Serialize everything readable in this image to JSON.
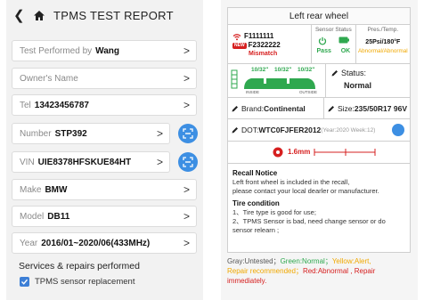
{
  "left": {
    "header": {
      "back_icon": "back-chevron",
      "home_icon": "home-icon",
      "title": "TPMS TEST REPORT"
    },
    "fields": [
      {
        "label": "Test Performed by",
        "value": "Wang"
      },
      {
        "label": "Owner's Name",
        "value": ""
      },
      {
        "label": "Tel",
        "value": "13423456787"
      },
      {
        "label": "Number",
        "value": "STP392"
      },
      {
        "label": "VIN",
        "value": "UIE8378HFSKUE84HT"
      },
      {
        "label": "Make",
        "value": "BMW"
      },
      {
        "label": "Model",
        "value": "DB11"
      },
      {
        "label": "Year",
        "value": "2016/01~2020/06(433MHz)"
      }
    ],
    "services_title": "Services & repairs performed",
    "service_item": "TPMS sensor replacement"
  },
  "right": {
    "title": "Left rear wheel",
    "sensor": {
      "id1": "F1111111",
      "badge": "NEW",
      "id2": "F2322222",
      "mismatch": "Mismatch",
      "status_header": "Sensor Status",
      "pass": "Pass",
      "ok": "OK",
      "pres_header": "Pres./Temp.",
      "pres_value": "25Psi/180°F",
      "pres_status": "Abnormal/Abnormal"
    },
    "tread": {
      "v1": "10/32\"",
      "v2": "10/32\"",
      "v3": "10/32\"",
      "inside": "INSIDE",
      "outside": "OUTSIDE"
    },
    "status_label": "Status:",
    "status_value": "Normal",
    "brand_label": "Brand:",
    "brand_value": "Continental",
    "size_label": "Size:",
    "size_value": "235/50R17 96V",
    "dot_label": "DOT:",
    "dot_value": "WTC0FJFER2012",
    "dot_note": "(Year:2020 Week:12)",
    "measure": "1.6mm",
    "recall": {
      "title": "Recall Notice",
      "line1": "Left front wheel is included in the recall,",
      "line2": "please contact your local dearler or manufacturer.",
      "tire_title": "Tire condition",
      "tire1": "1、Tire type is good for use;",
      "tire2": "2、TPMS Sensor is bad,   need change sensor or do sensor relearn ;"
    },
    "legend": {
      "gray": "Gray:Untested；",
      "green": "Green:Normal；",
      "yellow": "Yellow:Alert,",
      "repair": "Repair recommended；",
      "red": "Red:Abnormal , Repair immediately."
    }
  },
  "colors": {
    "blue": "#3d8fe3",
    "green": "#2fa84f",
    "red": "#d62020",
    "orange": "#f0a800"
  }
}
